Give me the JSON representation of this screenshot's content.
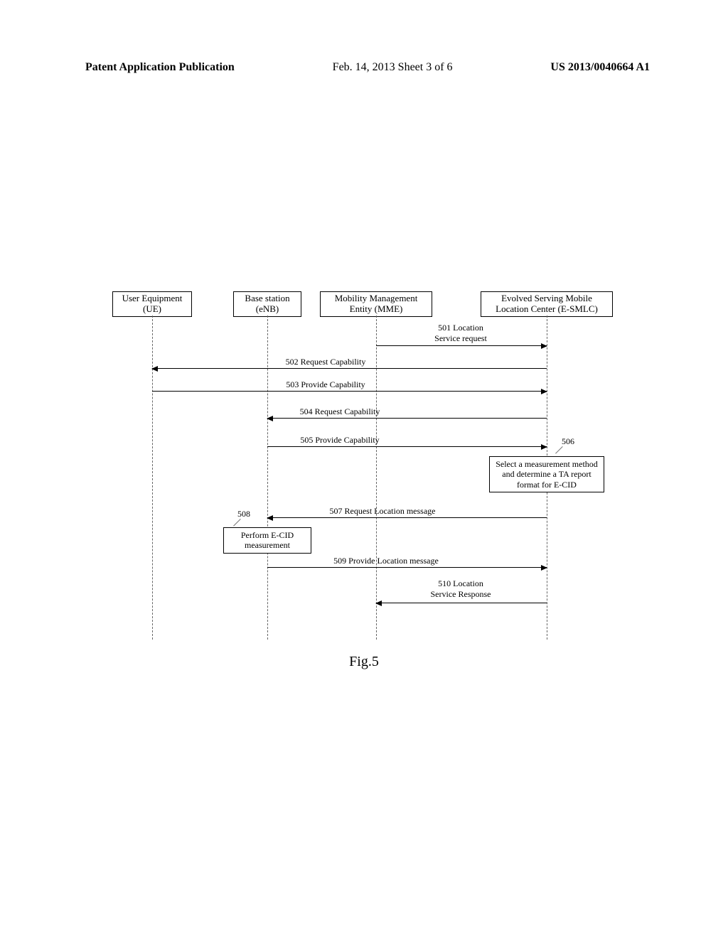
{
  "header": {
    "publication_label": "Patent Application Publication",
    "sheet": "Feb. 14, 2013  Sheet 3 of 6",
    "pub_number": "US 2013/0040664 A1"
  },
  "entities": {
    "ue": {
      "line1": "User Equipment",
      "line2": "(UE)"
    },
    "enb": {
      "line1": "Base station",
      "line2": "(eNB)"
    },
    "mme": {
      "line1": "Mobility Management",
      "line2": "Entity (MME)"
    },
    "smlc": {
      "line1": "Evolved Serving Mobile",
      "line2": "Location Center (E-SMLC)"
    }
  },
  "messages": {
    "m501": "501 Location\nService request",
    "m502": "502 Request Capability",
    "m503": "503 Provide Capability",
    "m504": "504 Request Capability",
    "m505": "505 Provide Capability",
    "m507": "507 Request Location message",
    "m509": "509 Provide Location message",
    "m510": "510 Location\nService Response"
  },
  "notes": {
    "n506": "Select a measurement method and determine a TA report format for E-CID",
    "n508": "Perform E-CID measurement"
  },
  "callouts": {
    "c506": "506",
    "c508": "508"
  },
  "caption": "Fig.5"
}
